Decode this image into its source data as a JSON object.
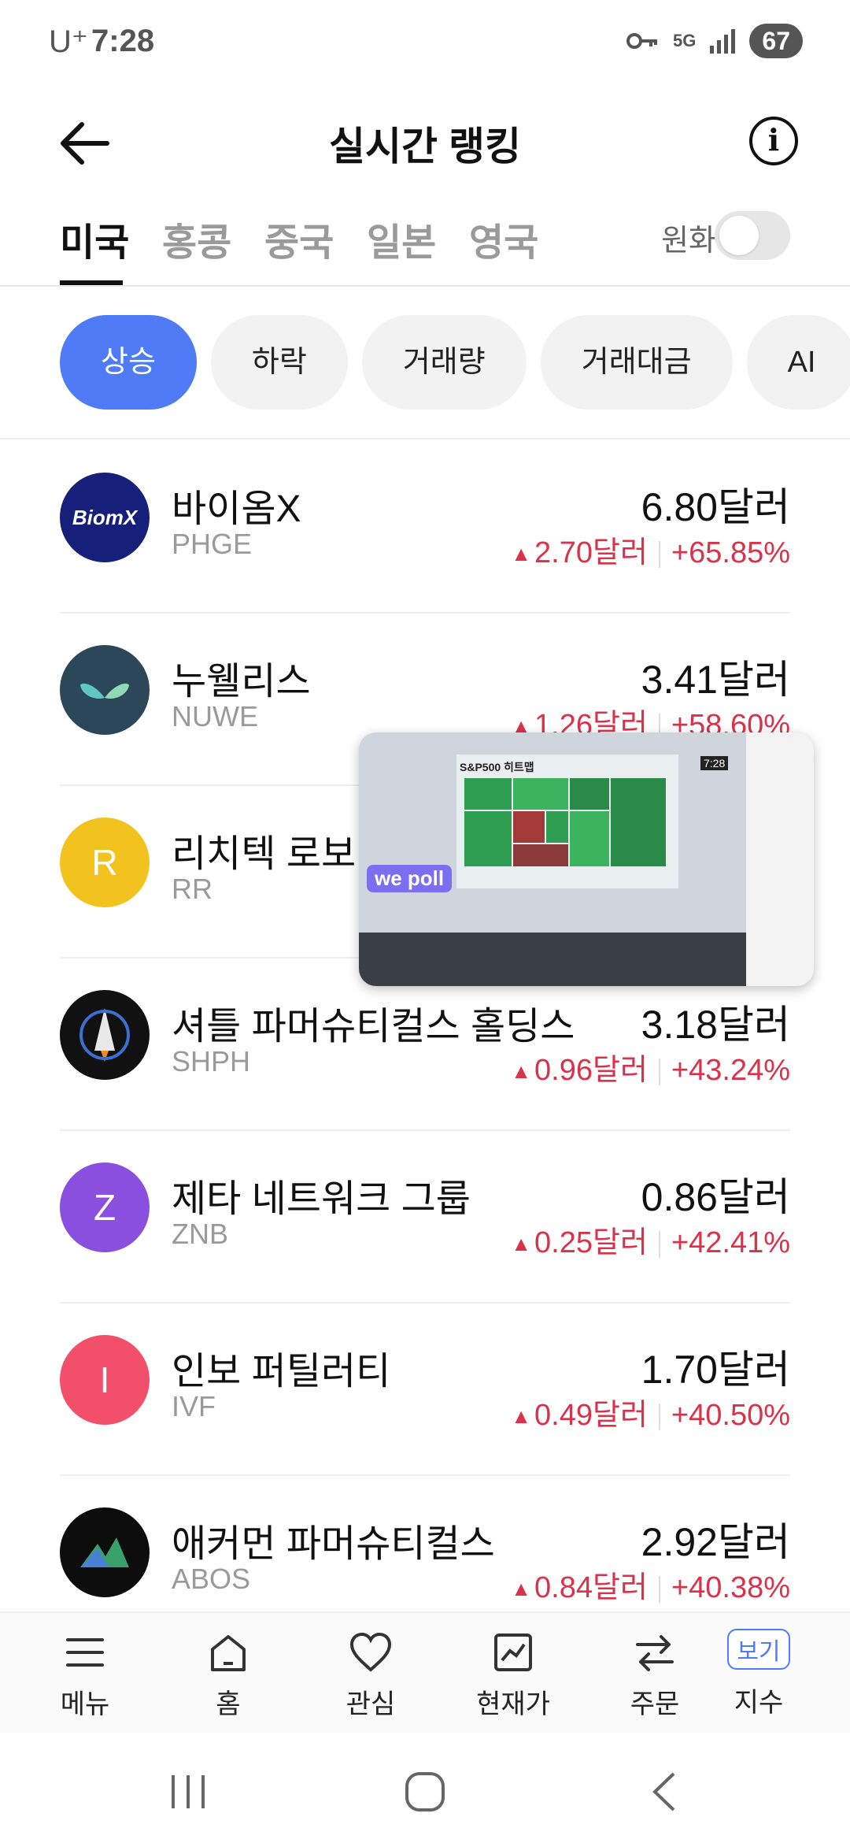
{
  "status_bar": {
    "carrier": "U⁺",
    "time": "7:28",
    "network": "5G",
    "battery": "67"
  },
  "header": {
    "title": "실시간 랭킹"
  },
  "market_tabs": {
    "tabs": [
      "미국",
      "홍콩",
      "중국",
      "일본",
      "영국"
    ],
    "active": "미국",
    "currency_label": "원화"
  },
  "filters": {
    "chips": [
      "상승",
      "하락",
      "거래량",
      "거래대금",
      "AI"
    ],
    "active": "상승"
  },
  "stocks": [
    {
      "name": "바이옴X",
      "ticker": "PHGE",
      "price": "6.80달러",
      "change": "2.70달러",
      "pct": "+65.85%",
      "logo_text": "BiomX",
      "logo_color": "#16207a"
    },
    {
      "name": "누웰리스",
      "ticker": "NUWE",
      "price": "3.41달러",
      "change": "1.26달러",
      "pct": "+58.60%",
      "logo_text": "",
      "logo_color": "#2c4757"
    },
    {
      "name": "리치텍 로보틱스",
      "ticker": "RR",
      "price": "",
      "change": "",
      "pct": "",
      "logo_text": "R",
      "logo_color": "#f2c21f"
    },
    {
      "name": "셔틀 파머슈티컬스 홀딩스",
      "ticker": "SHPH",
      "price": "3.18달러",
      "change": "0.96달러",
      "pct": "+43.24%",
      "logo_text": "",
      "logo_color": "#111111"
    },
    {
      "name": "제타 네트워크 그룹",
      "ticker": "ZNB",
      "price": "0.86달러",
      "change": "0.25달러",
      "pct": "+42.41%",
      "logo_text": "Z",
      "logo_color": "#8b4fe0"
    },
    {
      "name": "인보 퍼틸러티",
      "ticker": "IVF",
      "price": "1.70달러",
      "change": "0.49달러",
      "pct": "+40.50%",
      "logo_text": "I",
      "logo_color": "#f2506a"
    },
    {
      "name": "애커먼 파머슈티컬스",
      "ticker": "ABOS",
      "price": "2.92달러",
      "change": "0.84달러",
      "pct": "+40.38%",
      "logo_text": "",
      "logo_color": "#0d0d0d"
    }
  ],
  "pip_video": {
    "board_title": "S&P500 히트맵",
    "time": "7:28",
    "logo": "we poll"
  },
  "bottom_nav": {
    "items": [
      "메뉴",
      "홈",
      "관심",
      "현재가",
      "주문",
      "지수"
    ],
    "badge": "보기"
  },
  "colors": {
    "accent": "#4f7cf6",
    "up": "#d8334a"
  }
}
